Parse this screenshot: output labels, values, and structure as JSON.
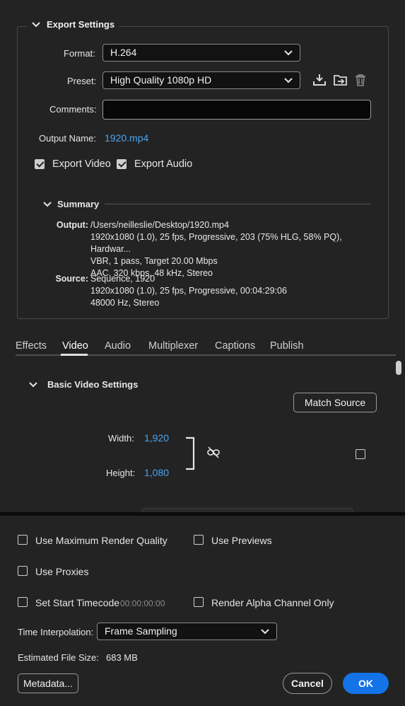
{
  "export_settings": {
    "title": "Export Settings",
    "format_label": "Format:",
    "format_value": "H.264",
    "preset_label": "Preset:",
    "preset_value": "High Quality 1080p HD",
    "comments_label": "Comments:",
    "comments_value": "",
    "output_name_label": "Output Name:",
    "output_name_value": "1920.mp4",
    "export_video_label": "Export Video",
    "export_video_checked": true,
    "export_audio_label": "Export Audio",
    "export_audio_checked": true
  },
  "summary": {
    "title": "Summary",
    "output_label": "Output:",
    "output_lines": [
      "/Users/neilleslie/Desktop/1920.mp4",
      "1920x1080 (1.0), 25 fps, Progressive, 203 (75% HLG, 58% PQ), Hardwar...",
      "VBR, 1 pass, Target 20.00 Mbps",
      "AAC, 320 kbps, 48 kHz, Stereo"
    ],
    "source_label": "Source:",
    "source_lines": [
      "Sequence, 1920",
      "1920x1080 (1.0), 25 fps, Progressive, 00:04:29:06",
      "48000 Hz, Stereo"
    ]
  },
  "tabs": [
    "Effects",
    "Video",
    "Audio",
    "Multiplexer",
    "Captions",
    "Publish"
  ],
  "active_tab": "Video",
  "video": {
    "section_title": "Basic Video Settings",
    "match_source_label": "Match Source",
    "width_label": "Width:",
    "width_value": "1,920",
    "height_label": "Height:",
    "height_value": "1,080"
  },
  "bottom": {
    "use_max_render_label": "Use Maximum Render Quality",
    "use_previews_label": "Use Previews",
    "use_proxies_label": "Use Proxies",
    "set_start_tc_label": "Set Start Timecode",
    "start_tc_value": "00:00:00:00",
    "render_alpha_label": "Render Alpha Channel Only",
    "time_interp_label": "Time Interpolation:",
    "time_interp_value": "Frame Sampling",
    "est_size_label": "Estimated File Size:",
    "est_size_value": "683 MB",
    "metadata_label": "Metadata...",
    "cancel_label": "Cancel",
    "ok_label": "OK"
  },
  "icons": [
    "chevron-down-icon",
    "save-preset-icon",
    "import-preset-icon",
    "delete-preset-icon",
    "unlink-icon"
  ],
  "colors": {
    "accent": "#4aa3f0",
    "ok_button": "#1473e6",
    "background": "#232323"
  }
}
